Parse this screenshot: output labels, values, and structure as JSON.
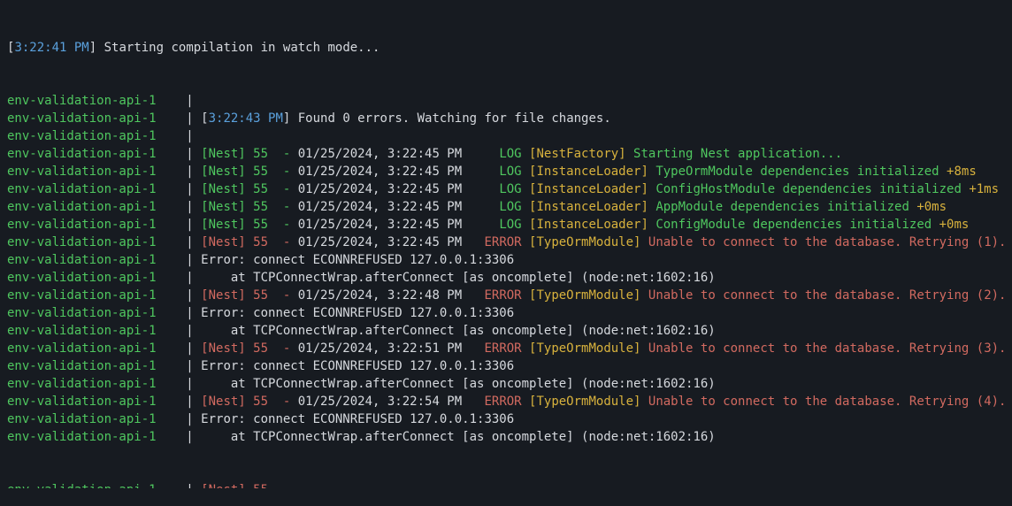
{
  "terminal": {
    "first": {
      "open": "[",
      "ts": "3:22:41 PM",
      "close": "]",
      "text": " Starting compilation in watch mode..."
    },
    "lines": [
      {
        "kind": "empty",
        "prefix": "env-validation-api-1    |"
      },
      {
        "kind": "info",
        "prefix": "env-validation-api-1    | ",
        "open": "[",
        "ts": "3:22:43 PM",
        "close": "]",
        "text": " Found 0 errors. Watching for file changes."
      },
      {
        "kind": "empty",
        "prefix": "env-validation-api-1    |"
      },
      {
        "kind": "log",
        "prefix": "env-validation-api-1    | ",
        "nest": "[Nest] 55  - ",
        "date": "01/25/2024, 3:22:45 PM",
        "lvl": "     LOG ",
        "ctx": "[NestFactory]",
        "msg": " Starting Nest application...",
        "dur": ""
      },
      {
        "kind": "log",
        "prefix": "env-validation-api-1    | ",
        "nest": "[Nest] 55  - ",
        "date": "01/25/2024, 3:22:45 PM",
        "lvl": "     LOG ",
        "ctx": "[InstanceLoader]",
        "msg": " TypeOrmModule dependencies initialized ",
        "dur": "+8ms"
      },
      {
        "kind": "log",
        "prefix": "env-validation-api-1    | ",
        "nest": "[Nest] 55  - ",
        "date": "01/25/2024, 3:22:45 PM",
        "lvl": "     LOG ",
        "ctx": "[InstanceLoader]",
        "msg": " ConfigHostModule dependencies initialized ",
        "dur": "+1ms"
      },
      {
        "kind": "log",
        "prefix": "env-validation-api-1    | ",
        "nest": "[Nest] 55  - ",
        "date": "01/25/2024, 3:22:45 PM",
        "lvl": "     LOG ",
        "ctx": "[InstanceLoader]",
        "msg": " AppModule dependencies initialized ",
        "dur": "+0ms"
      },
      {
        "kind": "log",
        "prefix": "env-validation-api-1    | ",
        "nest": "[Nest] 55  - ",
        "date": "01/25/2024, 3:22:45 PM",
        "lvl": "     LOG ",
        "ctx": "[InstanceLoader]",
        "msg": " ConfigModule dependencies initialized ",
        "dur": "+0ms"
      },
      {
        "kind": "err",
        "prefix": "env-validation-api-1    | ",
        "nest": "[Nest] 55  - ",
        "date": "01/25/2024, 3:22:45 PM",
        "lvl": "   ERROR ",
        "ctx": "[TypeOrmModule]",
        "msg": " Unable to connect to the database. Retrying (1)...",
        "dur": ""
      },
      {
        "kind": "plain",
        "prefix": "env-validation-api-1    | ",
        "text": "Error: connect ECONNREFUSED 127.0.0.1:3306"
      },
      {
        "kind": "plain",
        "prefix": "env-validation-api-1    | ",
        "text": "    at TCPConnectWrap.afterConnect [as oncomplete] (node:net:1602:16)"
      },
      {
        "kind": "err",
        "prefix": "env-validation-api-1    | ",
        "nest": "[Nest] 55  - ",
        "date": "01/25/2024, 3:22:48 PM",
        "lvl": "   ERROR ",
        "ctx": "[TypeOrmModule]",
        "msg": " Unable to connect to the database. Retrying (2)...",
        "dur": ""
      },
      {
        "kind": "plain",
        "prefix": "env-validation-api-1    | ",
        "text": "Error: connect ECONNREFUSED 127.0.0.1:3306"
      },
      {
        "kind": "plain",
        "prefix": "env-validation-api-1    | ",
        "text": "    at TCPConnectWrap.afterConnect [as oncomplete] (node:net:1602:16)"
      },
      {
        "kind": "err",
        "prefix": "env-validation-api-1    | ",
        "nest": "[Nest] 55  - ",
        "date": "01/25/2024, 3:22:51 PM",
        "lvl": "   ERROR ",
        "ctx": "[TypeOrmModule]",
        "msg": " Unable to connect to the database. Retrying (3)...",
        "dur": ""
      },
      {
        "kind": "plain",
        "prefix": "env-validation-api-1    | ",
        "text": "Error: connect ECONNREFUSED 127.0.0.1:3306"
      },
      {
        "kind": "plain",
        "prefix": "env-validation-api-1    | ",
        "text": "    at TCPConnectWrap.afterConnect [as oncomplete] (node:net:1602:16)"
      },
      {
        "kind": "err",
        "prefix": "env-validation-api-1    | ",
        "nest": "[Nest] 55  - ",
        "date": "01/25/2024, 3:22:54 PM",
        "lvl": "   ERROR ",
        "ctx": "[TypeOrmModule]",
        "msg": " Unable to connect to the database. Retrying (4)...",
        "dur": ""
      },
      {
        "kind": "plain",
        "prefix": "env-validation-api-1    | ",
        "text": "Error: connect ECONNREFUSED 127.0.0.1:3306"
      },
      {
        "kind": "plain",
        "prefix": "env-validation-api-1    | ",
        "text": "    at TCPConnectWrap.afterConnect [as oncomplete] (node:net:1602:16)"
      }
    ]
  }
}
